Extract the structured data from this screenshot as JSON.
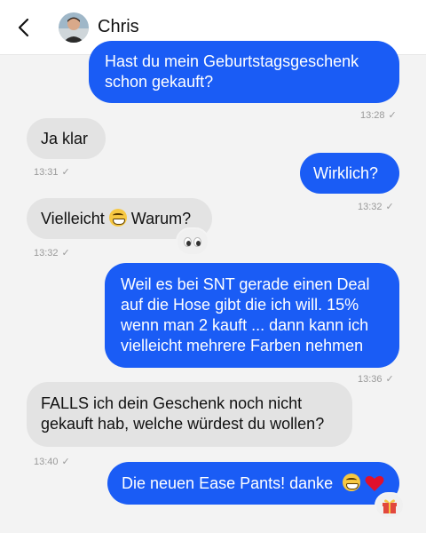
{
  "header": {
    "contact_name": "Chris",
    "back_icon": "chevron-left-icon",
    "avatar": "profile-photo"
  },
  "messages": [
    {
      "direction": "out",
      "text": "Hast du mein Geburtstagsgeschenk schon gekauft?",
      "time": "13:28",
      "status": "✓"
    },
    {
      "direction": "in",
      "text": "Ja klar",
      "time": "13:31",
      "status": "✓"
    },
    {
      "direction": "out",
      "text": "Wirklich?",
      "time": "13:32",
      "status": "✓"
    },
    {
      "direction": "in",
      "text_before": "Vielleicht",
      "emoji": "grinning-face",
      "text_after": "Warum?",
      "reaction": "eyes-emoji",
      "time": "13:32",
      "status": "✓"
    },
    {
      "direction": "out",
      "text": "Weil es bei SNT gerade einen Deal auf die Hose gibt die ich will. 15% wenn man 2 kauft ... dann kann ich vielleicht mehrere Farben nehmen",
      "time": "13:36",
      "status": "✓"
    },
    {
      "direction": "in",
      "text": "FALLS ich dein Geschenk noch nicht gekauft hab, welche würdest du wollen?",
      "time": "13:40",
      "status": "✓"
    },
    {
      "direction": "out",
      "text": "Die neuen Ease Pants! danke",
      "emojis": [
        "grinning-face",
        "red-heart"
      ],
      "reaction": "gift-emoji"
    }
  ],
  "colors": {
    "outgoing_bubble": "#1a5cf5",
    "incoming_bubble": "#e3e3e3",
    "background": "#f3f3f3"
  }
}
